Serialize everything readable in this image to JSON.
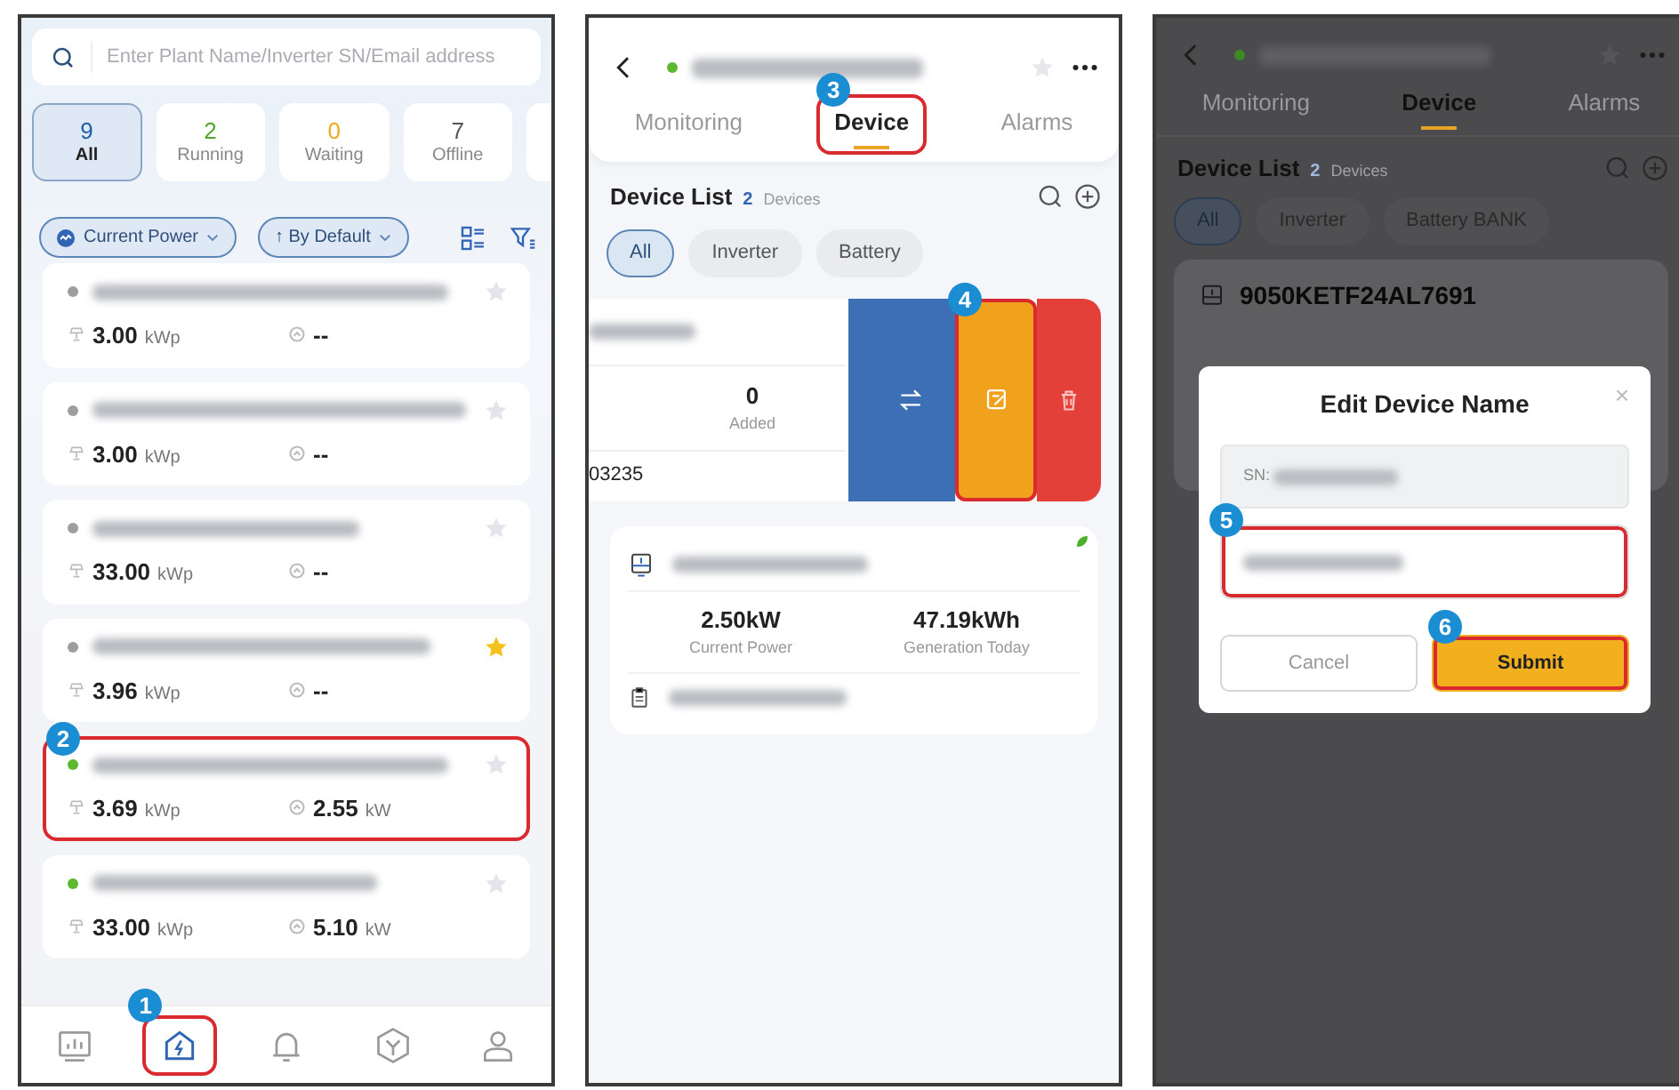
{
  "plant_list": {
    "search": {
      "placeholder": "Enter Plant Name/Inverter SN/Email address"
    },
    "status_tabs": [
      {
        "count": "9",
        "label": "All",
        "selected": true,
        "color": "#1f5fa8"
      },
      {
        "count": "2",
        "label": "Running",
        "selected": false,
        "color": "#52a82e"
      },
      {
        "count": "0",
        "label": "Waiting",
        "selected": false,
        "color": "#f0a91c"
      },
      {
        "count": "7",
        "label": "Offline",
        "selected": false,
        "color": "#555555"
      }
    ],
    "filters": [
      {
        "label": "Current Power",
        "kind": "power"
      },
      {
        "label": "↑ By Default",
        "kind": "sort"
      }
    ],
    "plants": [
      {
        "color": "#9e9e9e",
        "starred": false,
        "capacity": "3.00",
        "capacity_unit": "kWp",
        "power": "--",
        "highlighted": false
      },
      {
        "color": "#9e9e9e",
        "starred": false,
        "capacity": "3.00",
        "capacity_unit": "kWp",
        "power": "--",
        "highlighted": false
      },
      {
        "color": "#9e9e9e",
        "starred": false,
        "capacity": "33.00",
        "capacity_unit": "kWp",
        "power": "--",
        "highlighted": false
      },
      {
        "color": "#9e9e9e",
        "starred": true,
        "capacity": "3.96",
        "capacity_unit": "kWp",
        "power": "--",
        "highlighted": false
      },
      {
        "color": "#5cb82e",
        "starred": false,
        "capacity": "3.69",
        "capacity_unit": "kWp",
        "power": "2.55",
        "power_unit": "kW",
        "highlighted": true,
        "step": "2"
      },
      {
        "color": "#5cb82e",
        "starred": false,
        "capacity": "33.00",
        "capacity_unit": "kWp",
        "power": "5.10",
        "power_unit": "kW",
        "highlighted": false
      }
    ],
    "nav": [
      {
        "kind": "chart",
        "selected": false,
        "highlighted": false
      },
      {
        "kind": "home",
        "selected": true,
        "highlighted": true,
        "step": "1"
      },
      {
        "kind": "bell",
        "selected": false,
        "highlighted": false
      },
      {
        "kind": "cube",
        "selected": false,
        "highlighted": false
      },
      {
        "kind": "user",
        "selected": false,
        "highlighted": false
      }
    ]
  },
  "device_page": {
    "tabs": [
      {
        "label": "Monitoring",
        "selected": false,
        "highlighted": false
      },
      {
        "label": "Device",
        "selected": true,
        "highlighted": true,
        "step": "3"
      },
      {
        "label": "Alarms",
        "selected": false,
        "highlighted": false
      }
    ],
    "list_title": "Device List",
    "device_count": "2",
    "device_count_label": "Devices",
    "chips": [
      {
        "label": "All",
        "selected": true
      },
      {
        "label": "Inverter",
        "selected": false
      },
      {
        "label": "Battery",
        "selected": false
      }
    ],
    "swiped_card": {
      "added_count": "0",
      "added_label": "Added",
      "serial_tail": "03235",
      "actions": [
        {
          "kind": "swap",
          "highlighted": false
        },
        {
          "kind": "edit",
          "highlighted": true,
          "step": "4"
        },
        {
          "kind": "delete",
          "highlighted": false
        }
      ]
    },
    "device_card": {
      "stats": [
        {
          "value": "2.50kW",
          "label": "Current Power"
        },
        {
          "value": "47.19kWh",
          "label": "Generation Today"
        }
      ]
    }
  },
  "edit_page": {
    "tabs": [
      {
        "label": "Monitoring",
        "selected": false
      },
      {
        "label": "Device",
        "selected": true
      },
      {
        "label": "Alarms",
        "selected": false
      }
    ],
    "list_title": "Device List",
    "device_count": "2",
    "device_count_label": "Devices",
    "chips": [
      {
        "label": "All",
        "selected": true
      },
      {
        "label": "Inverter",
        "selected": false
      },
      {
        "label": "Battery BANK",
        "selected": false
      }
    ],
    "device_name": "9050KETF24AL7691",
    "dialog": {
      "title": "Edit Device Name",
      "close": "×",
      "sn_label": "SN:",
      "name_field_highlighted": true,
      "name_field_step": "5",
      "buttons": [
        {
          "label": "Cancel",
          "kind": "secondary",
          "highlighted": false
        },
        {
          "label": "Submit",
          "kind": "primary",
          "highlighted": true,
          "step": "6"
        }
      ]
    }
  }
}
